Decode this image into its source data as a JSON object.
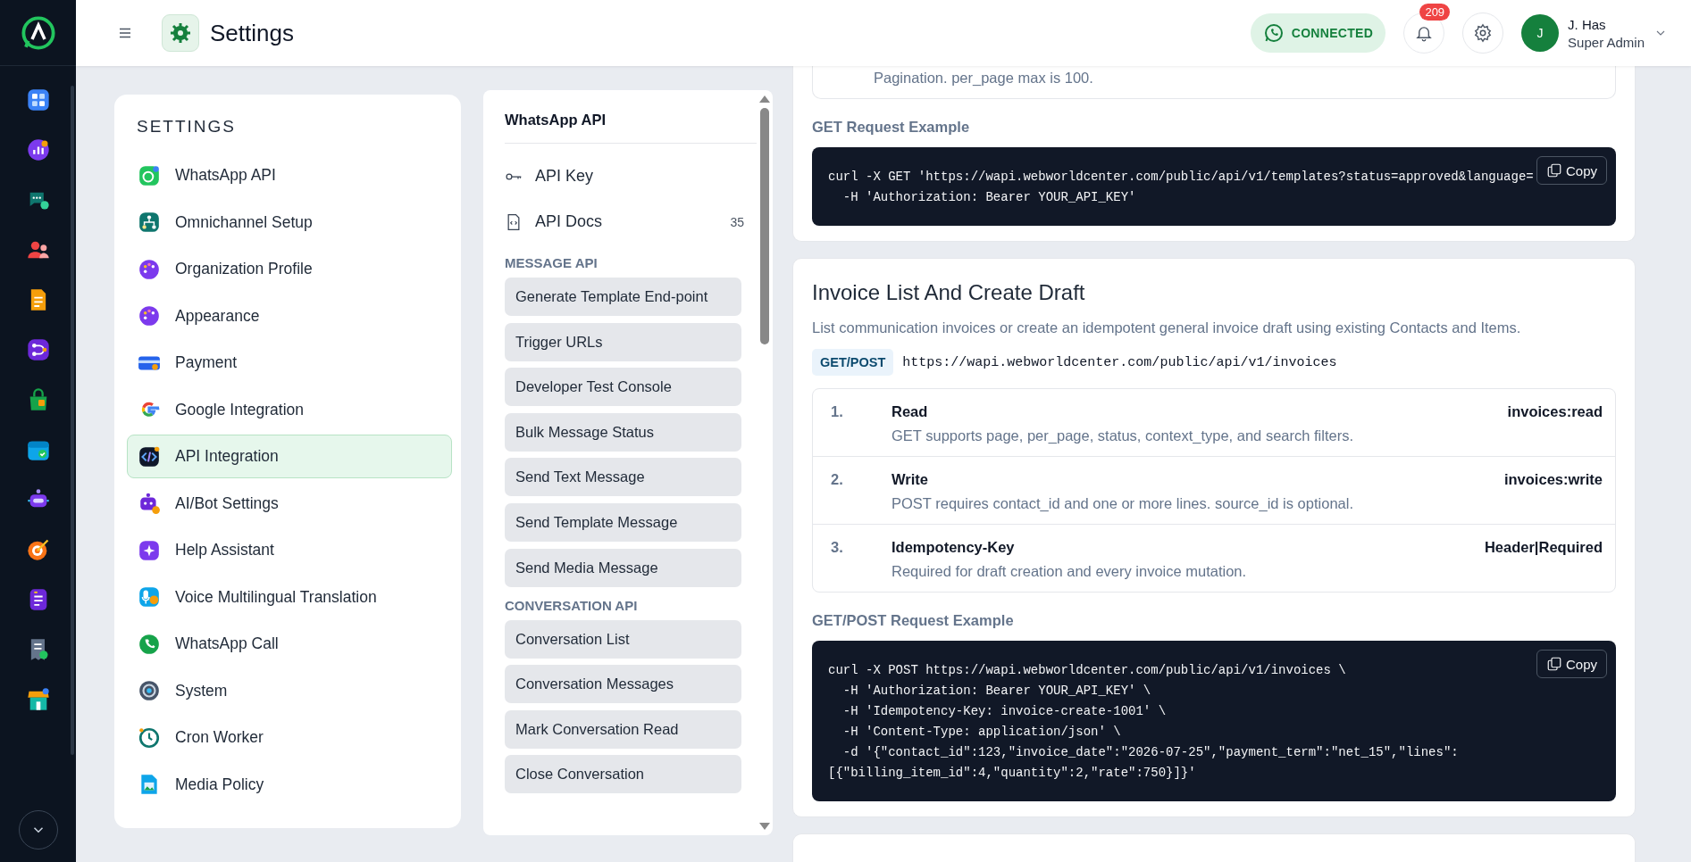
{
  "topbar": {
    "title": "Settings",
    "connection": {
      "label": "CONNECTED",
      "connected": true
    },
    "notifications": {
      "count": "209"
    },
    "user": {
      "initial": "J",
      "name": "J. Has",
      "role": "Super Admin"
    }
  },
  "settings_menu": {
    "title": "SETTINGS",
    "items": [
      {
        "label": "WhatsApp API",
        "selected": false
      },
      {
        "label": "Omnichannel Setup",
        "selected": false
      },
      {
        "label": "Organization Profile",
        "selected": false
      },
      {
        "label": "Appearance",
        "selected": false
      },
      {
        "label": "Payment",
        "selected": false
      },
      {
        "label": "Google Integration",
        "selected": false
      },
      {
        "label": "API Integration",
        "selected": true
      },
      {
        "label": "AI/Bot Settings",
        "selected": false
      },
      {
        "label": "Help Assistant",
        "selected": false
      },
      {
        "label": "Voice Multilingual Translation",
        "selected": false
      },
      {
        "label": "WhatsApp Call",
        "selected": false
      },
      {
        "label": "System",
        "selected": false
      },
      {
        "label": "Cron Worker",
        "selected": false
      },
      {
        "label": "Media Policy",
        "selected": false
      }
    ]
  },
  "api_nav": {
    "title": "WhatsApp API",
    "links": [
      {
        "kind": "key",
        "label": "API Key"
      },
      {
        "kind": "docs",
        "label": "API Docs",
        "count": "35"
      }
    ],
    "sections": [
      {
        "title": "MESSAGE API",
        "items": [
          "Generate Template End-point",
          "Trigger URLs",
          "Developer Test Console",
          "Bulk Message Status",
          "Send Text Message",
          "Send Template Message",
          "Send Media Message"
        ]
      },
      {
        "title": "CONVERSATION API",
        "items": [
          "Conversation List",
          "Conversation Messages",
          "Mark Conversation Read",
          "Close Conversation"
        ]
      }
    ]
  },
  "content": {
    "previous_section": {
      "note": "Pagination. per_page max is 100.",
      "example_label": "GET Request Example",
      "code": [
        "curl -X GET 'https://wapi.webworldcenter.com/public/api/v1/templates?status=approved&language=",
        "  -H 'Authorization: Bearer YOUR_API_KEY'"
      ],
      "copy_label": "Copy"
    },
    "section": {
      "title": "Invoice List And Create Draft",
      "description": "List communication invoices or create an idempotent general invoice draft using existing Contacts and Items.",
      "method": "GET/POST",
      "url": "https://wapi.webworldcenter.com/public/api/v1/invoices",
      "rules": [
        {
          "number": "1.",
          "name": "Read",
          "detail": "GET supports page, per_page, status, context_type, and search filters.",
          "scope": "invoices:read"
        },
        {
          "number": "2.",
          "name": "Write",
          "detail": "POST requires contact_id and one or more lines. source_id is optional.",
          "scope": "invoices:write"
        },
        {
          "number": "3.",
          "name": "Idempotency-Key",
          "detail": "Required for draft creation and every invoice mutation.",
          "scope": "Header|Required"
        }
      ],
      "example_label": "GET/POST Request Example",
      "code": [
        "curl -X POST https://wapi.webworldcenter.com/public/api/v1/invoices \\",
        "  -H 'Authorization: Bearer YOUR_API_KEY' \\",
        "  -H 'Idempotency-Key: invoice-create-1001' \\",
        "  -H 'Content-Type: application/json' \\",
        "  -d '{\"contact_id\":123,\"invoice_date\":\"2026-07-25\",\"payment_term\":\"net_15\",\"lines\":",
        "[{\"billing_item_id\":4,\"quantity\":2,\"rate\":750}]}'"
      ],
      "copy_label": "Copy"
    }
  }
}
